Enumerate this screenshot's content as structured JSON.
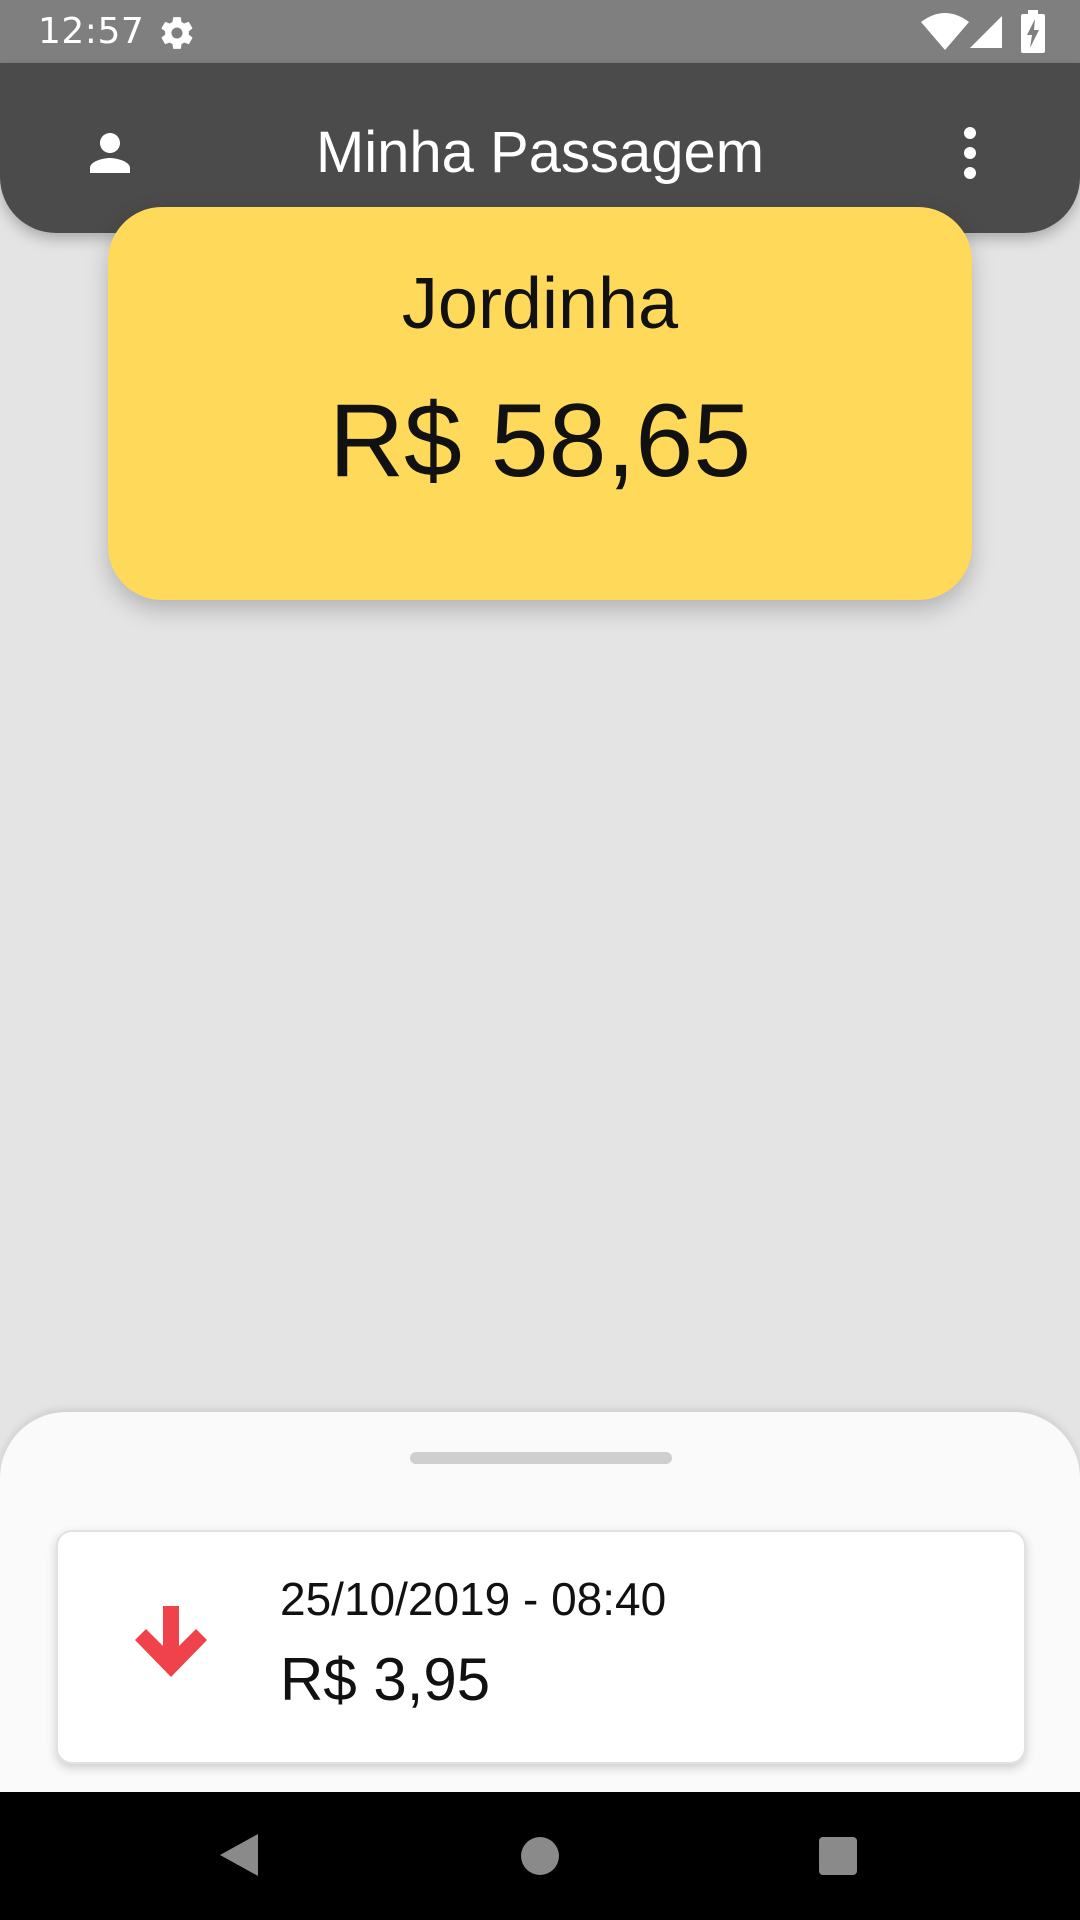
{
  "status_bar": {
    "time": "12:57",
    "icons": [
      "gear-icon",
      "wifi-icon",
      "signal-icon",
      "battery-charging-icon"
    ]
  },
  "app_bar": {
    "title": "Minha Passagem",
    "left_icon": "person-icon",
    "right_icon": "more-vert-icon"
  },
  "balance_card": {
    "name": "Jordinha",
    "balance": "R$ 58,65"
  },
  "transactions": [
    {
      "icon": "arrow-down-icon",
      "datetime": "25/10/2019 - 08:40",
      "amount": "R$ 3,95"
    }
  ],
  "nav_bar": {
    "icons": [
      "back-icon",
      "home-icon",
      "recents-icon"
    ]
  },
  "colors": {
    "status_bar": "#7f7f7f",
    "app_bar": "#4b4b4b",
    "background": "#e5e4e4",
    "card": "#ffd95a",
    "debit_arrow": "#f0424a",
    "sheet": "#fafafa"
  }
}
